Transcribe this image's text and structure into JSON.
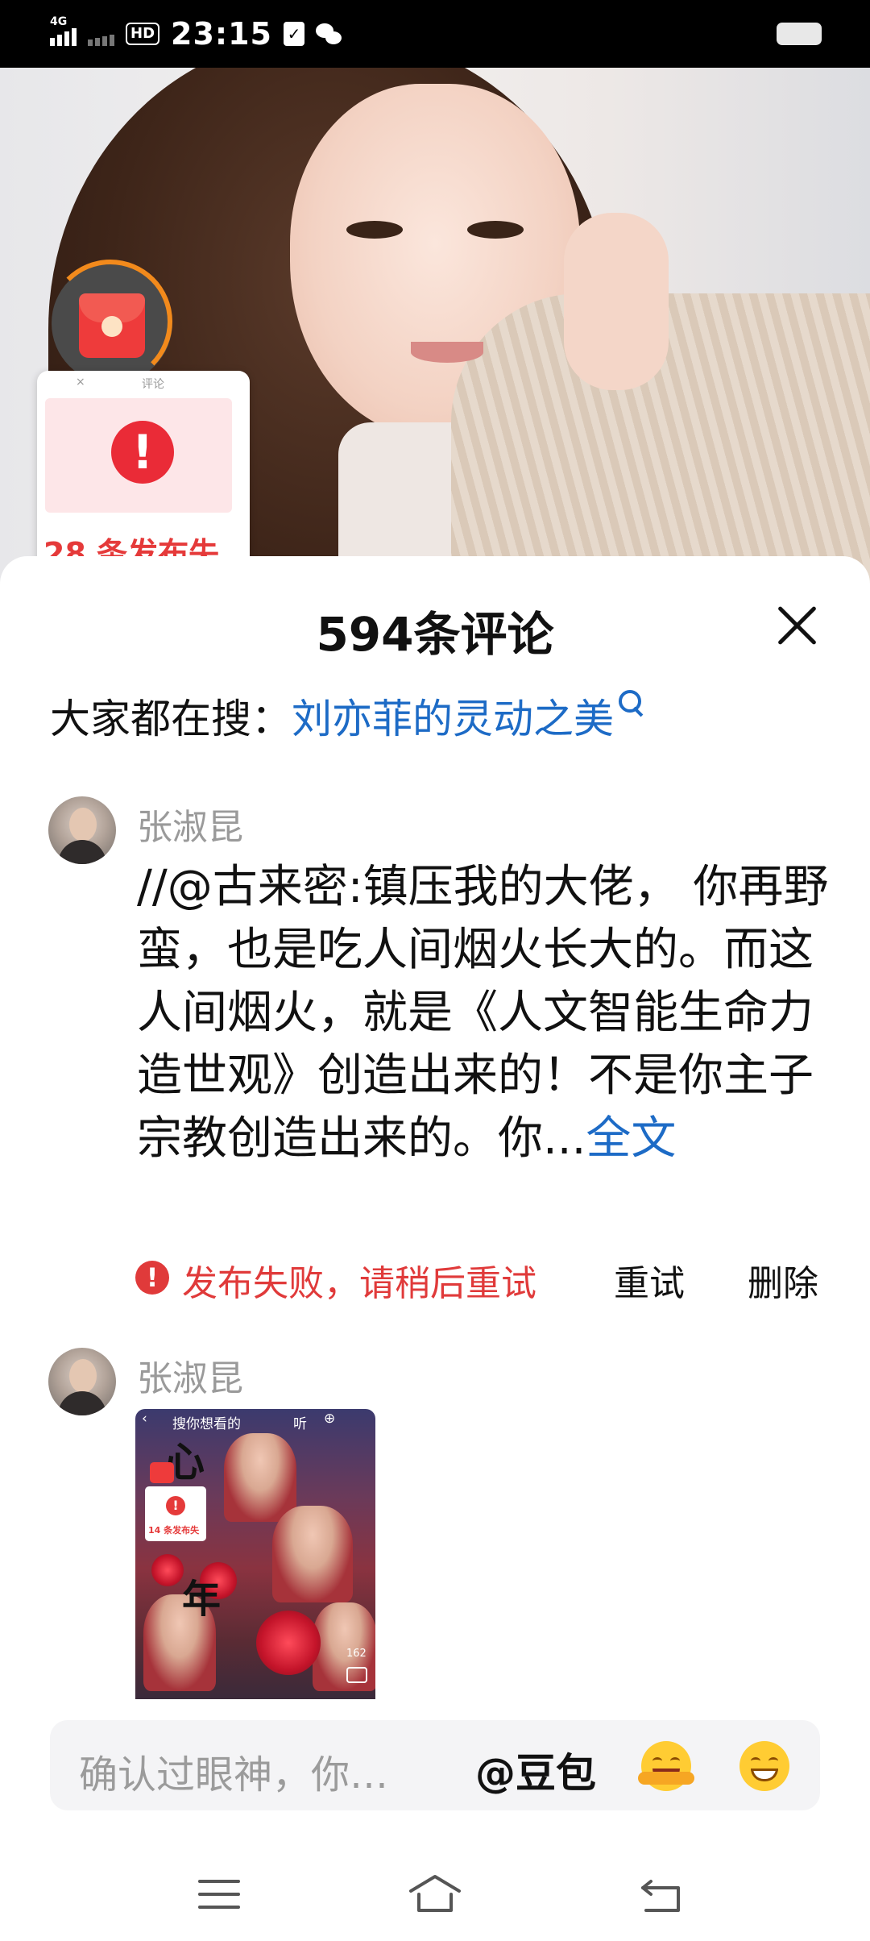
{
  "status_bar": {
    "network_label": "4G",
    "hd_label": "HD",
    "time": "23:15"
  },
  "floating_widget": {
    "mini_title": "评论",
    "mini_close": "×",
    "fail_text": "28 条发布失"
  },
  "comments_panel": {
    "title": "594条评论",
    "search_prefix": "大家都在搜：",
    "search_link": "刘亦菲的灵动之美"
  },
  "comments": [
    {
      "author": "张淑昆",
      "text": "//@古来密:镇压我的大佬， 你再野蛮，也是吃人间烟火长大的。而这人间烟火，就是《人文智能生命力造世观》创造出来的！不是你主子宗教创造出来的。你...",
      "more_label": "全文",
      "status_text": "发布失败，请稍后重试",
      "retry_label": "重试",
      "delete_label": "删除"
    },
    {
      "author": "张淑昆",
      "image": {
        "search_placeholder": "搜你想看的",
        "listen_label": "听",
        "char_1": "心",
        "char_2": "年",
        "fail_text": "14 条发布失",
        "count": "162"
      }
    }
  ],
  "input_bar": {
    "placeholder": "确认过眼神，你…",
    "mention_label": "@豆包"
  },
  "colors": {
    "link_blue": "#1d6bc6",
    "error_red": "#e03a3a",
    "progress_orange": "#f28a1c"
  }
}
